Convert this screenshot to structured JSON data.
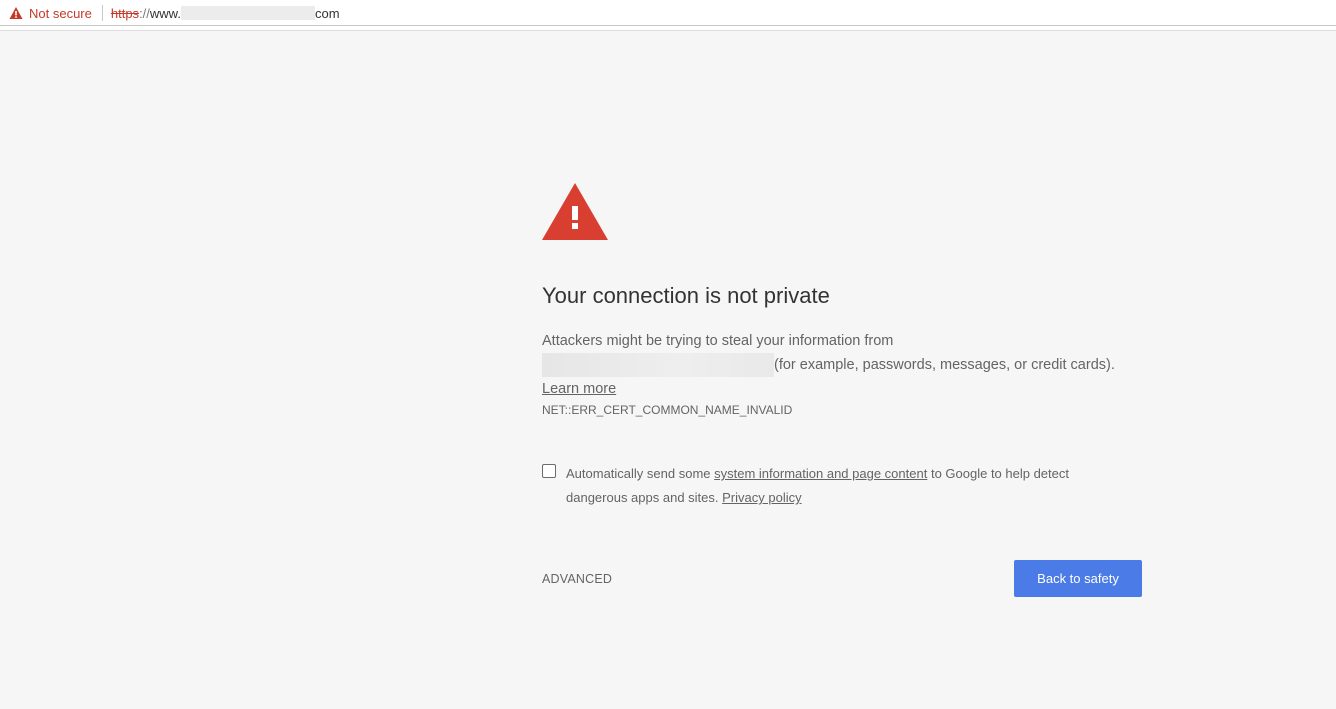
{
  "addressbar": {
    "security_label": "Not secure",
    "scheme": "https",
    "scheme_separator": "://",
    "host_prefix": "www.",
    "host_suffix": "com",
    "warn_icon": "warning-triangle-icon",
    "warn_color": "#c5392a"
  },
  "interstitial": {
    "icon": "warning-triangle-icon",
    "icon_color": "#d93f30",
    "title": "Your connection is not private",
    "description_before": "Attackers might be trying to steal your information from",
    "description_after": "(for example, passwords, messages, or credit cards).",
    "learn_more": "Learn more",
    "error_code": "NET::ERR_CERT_COMMON_NAME_INVALID",
    "checkbox": {
      "checked": false,
      "text_before": "Automatically send some",
      "link_text": "system information and page content",
      "text_middle": "to Google to help detect dangerous apps and sites.",
      "privacy_link": "Privacy policy"
    },
    "advanced_label": "ADVANCED",
    "back_button_label": "Back to safety",
    "button_color": "#4b7be6"
  }
}
